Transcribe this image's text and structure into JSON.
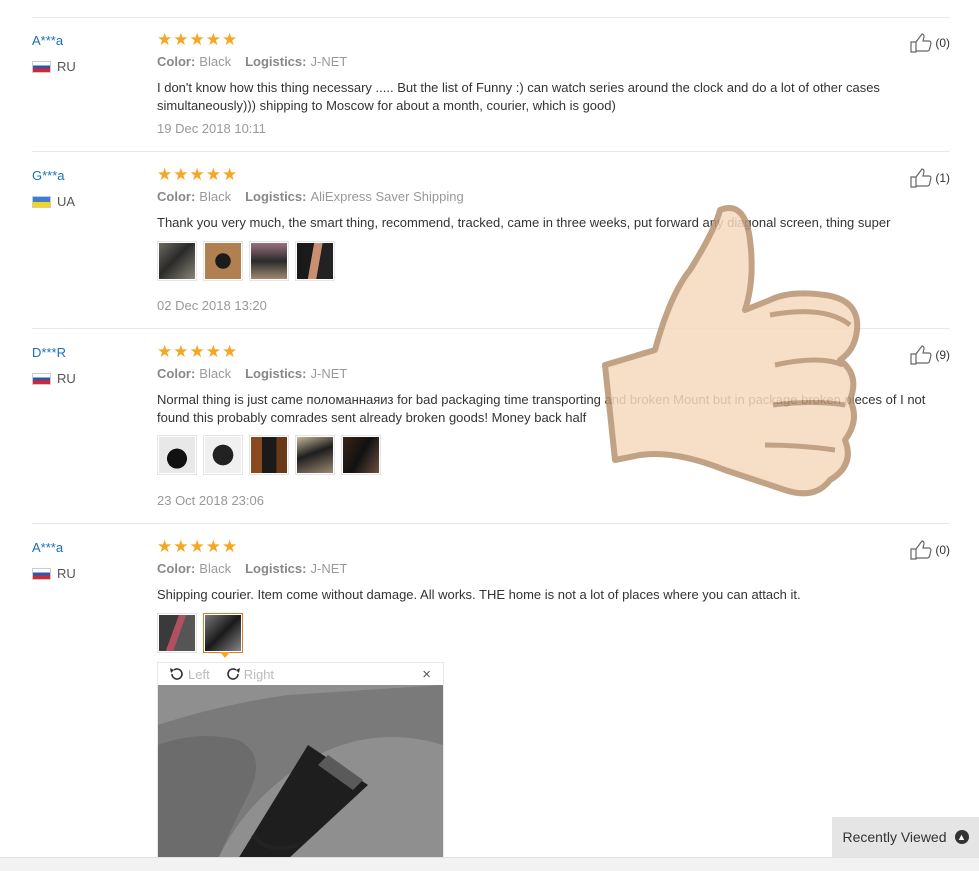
{
  "reviews": [
    {
      "user": "A***a",
      "country": "RU",
      "flag": "ru",
      "stars": "★★★★★",
      "color_label": "Color:",
      "color": "Black",
      "logistics_label": "Logistics:",
      "logistics": "J-NET",
      "text": "I don't know how this thing necessary ..... But the list of Funny :) can watch series around the clock and do a lot of other cases simultaneously))) shipping to Moscow for about a month, courier, which is good)",
      "date": "19 Dec 2018 10:11",
      "helpful": "(0)"
    },
    {
      "user": "G***a",
      "country": "UA",
      "flag": "ua",
      "stars": "★★★★★",
      "color_label": "Color:",
      "color": "Black",
      "logistics_label": "Logistics:",
      "logistics": "AliExpress Saver Shipping",
      "text": "Thank you very much, the smart thing, recommend, tracked, came in three weeks, put forward any diagonal screen, thing super",
      "date": "02 Dec 2018 13:20",
      "helpful": "(1)"
    },
    {
      "user": "D***R",
      "country": "RU",
      "flag": "ru",
      "stars": "★★★★★",
      "color_label": "Color:",
      "color": "Black",
      "logistics_label": "Logistics:",
      "logistics": "J-NET",
      "text": "Normal thing is just came поломаннаяиз for bad packaging time transporting and broken Mount but in package broken pieces of I not found this probably comrades sent already broken goods! Money back half",
      "date": "23 Oct 2018 23:06",
      "helpful": "(9)"
    },
    {
      "user": "A***a",
      "country": "RU",
      "flag": "ru",
      "stars": "★★★★★",
      "color_label": "Color:",
      "color": "Black",
      "logistics_label": "Logistics:",
      "logistics": "J-NET",
      "text": "Shipping courier. Item come without damage. All works. THE home is not a lot of places where you can attach it.",
      "helpful": "(0)"
    }
  ],
  "viewer": {
    "left_label": "Left",
    "right_label": "Right",
    "close": "×"
  },
  "recently_viewed": {
    "label": "Recently Viewed",
    "icon": "chevron-up-icon"
  },
  "colors": {
    "link": "#1a6fba",
    "star": "#f5a623",
    "selected_border": "#e07b26"
  }
}
